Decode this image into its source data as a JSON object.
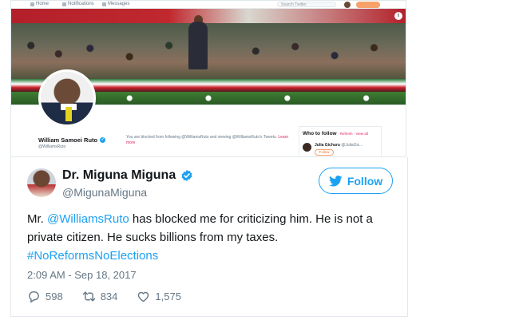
{
  "screenshot": {
    "nav": {
      "home": "Home",
      "notifications": "Notifications",
      "messages": "Messages",
      "search_placeholder": "Search Twitter"
    },
    "profile": {
      "name": "William Samoei Ruto",
      "handle": "@WilliamsRuto"
    },
    "blocked_message": {
      "text": "You are blocked from following @WilliamsRuto and viewing @WilliamsRuto's Tweets.",
      "learn_more": "Learn more"
    },
    "who_to_follow": {
      "title": "Who to follow",
      "links": "· Refresh · View all",
      "user_name": "Julia Gichuru",
      "user_handle": "@JuliaGic...",
      "follow_label": "Follow"
    }
  },
  "tweet": {
    "author": {
      "name": "Dr. Miguna Miguna",
      "handle": "@MigunaMiguna"
    },
    "follow_label": "Follow",
    "text": {
      "part1": "Mr. ",
      "mention": "@WilliamsRuto",
      "part2": " has blocked me for criticizing him. He is not a private citizen. He sucks billions from my taxes.",
      "hashtag": "#NoReformsNoElections"
    },
    "timestamp": "2:09 AM - Sep 18, 2017",
    "stats": {
      "replies": "598",
      "retweets": "834",
      "likes": "1,575"
    },
    "colors": {
      "accent": "#1da1f2",
      "text": "#14171a",
      "muted": "#657786"
    }
  }
}
